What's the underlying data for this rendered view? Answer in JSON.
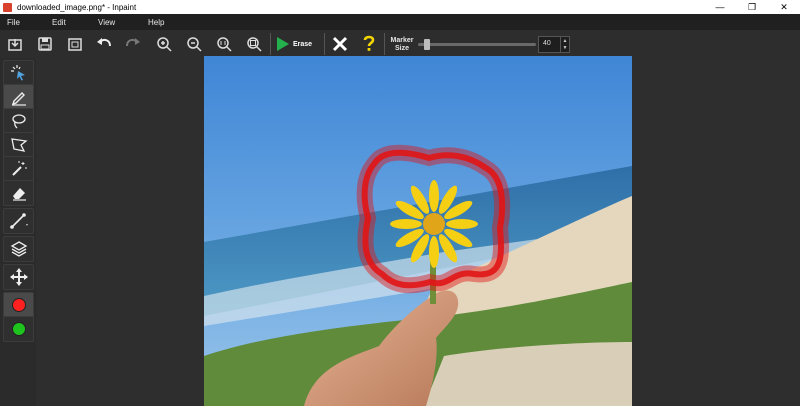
{
  "window": {
    "title": "downloaded_image.png* - Inpaint",
    "minimize": "—",
    "maximize": "❐",
    "close": "✕"
  },
  "menu": [
    "File",
    "Edit",
    "View",
    "Help"
  ],
  "toolbar": {
    "erase_label": "Erase",
    "marker_size_label": "Marker Size",
    "marker_size_value": "40"
  },
  "marker_size_fraction": 0.05,
  "colors": {
    "accent_green": "#22b14c",
    "red_marker": "#ff2020",
    "green_marker": "#1ec31e",
    "help_yellow": "#f2d600"
  },
  "icons": {
    "toolbar": [
      "open-icon",
      "save-icon",
      "save-as-icon",
      "undo-icon",
      "redo-icon",
      "zoom-in-icon",
      "zoom-out-icon",
      "zoom-actual-icon",
      "zoom-fit-icon",
      "erase-play-icon",
      "clear-icon",
      "help-icon"
    ],
    "sidebar": [
      "selection-icon",
      "marker-icon",
      "lasso-icon",
      "polygon-lasso-icon",
      "magic-wand-icon",
      "eraser-icon",
      "line-icon",
      "layers-icon",
      "move-icon",
      "red-color-icon",
      "green-color-icon"
    ]
  }
}
